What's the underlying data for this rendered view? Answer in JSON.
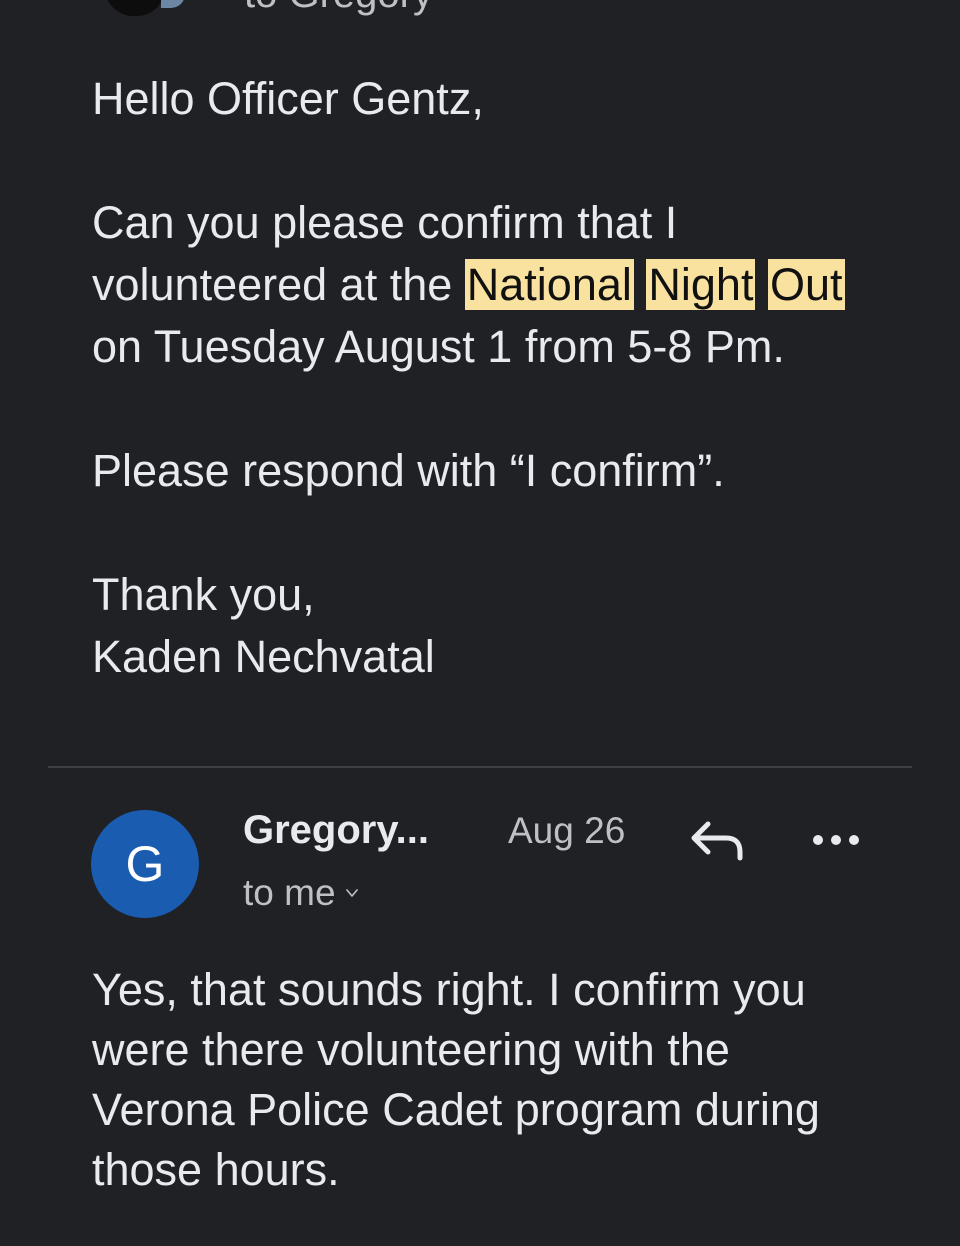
{
  "previous_message": {
    "recipient_line": "to Gregory",
    "greeting": "Hello Officer Gentz,",
    "body_before": "Can you please confirm that I volunteered  at the ",
    "highlight_1": "National",
    "highlight_2": "Night",
    "highlight_3": "Out",
    "body_after": " on Tuesday August 1 from 5-8 Pm.",
    "request": "Please respond with “I confirm”.",
    "signoff": "Thank you,",
    "signature": "Kaden Nechvatal"
  },
  "reply_message": {
    "avatar_letter": "G",
    "avatar_color": "#1a5cb0",
    "sender": "Gregory...",
    "date": "Aug 26",
    "recipient_line": "to me",
    "body": "Yes, that sounds right. I confirm you were there volunteering with the Verona Police Cadet program during those hours."
  },
  "icons": {
    "reply": "reply-icon",
    "more": "more-options-icon",
    "expand": "chevron-down-icon"
  },
  "colors": {
    "background": "#202124",
    "text": "#e8eaed",
    "secondary_text": "#bdc1c6",
    "highlight": "#f9e29f"
  }
}
